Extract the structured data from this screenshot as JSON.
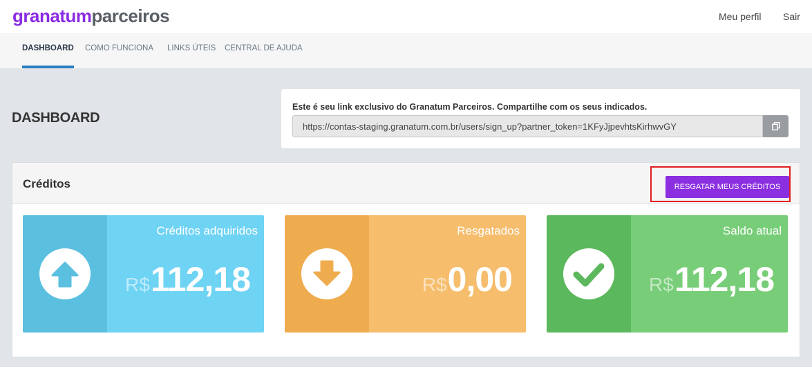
{
  "brand": {
    "part1": "granatum",
    "part2": "parceiros"
  },
  "topnav": {
    "profile": "Meu perfil",
    "logout": "Sair"
  },
  "nav": {
    "items": [
      {
        "label": "DASHBOARD",
        "active": true
      },
      {
        "label": "COMO FUNCIONA",
        "active": false
      },
      {
        "label": "LINKS ÚTEIS",
        "active": false
      },
      {
        "label": "CENTRAL DE AJUDA",
        "active": false
      }
    ]
  },
  "page": {
    "title": "DASHBOARD"
  },
  "referral": {
    "label": "Este é seu link exclusivo do Granatum Parceiros. Compartilhe com os seus indicados.",
    "url": "https://contas-staging.granatum.com.br/users/sign_up?partner_token=1KFyJjpevhtsKirhwvGY",
    "copy_icon": "copy-icon"
  },
  "credits": {
    "title": "Créditos",
    "redeem_button": "RESGATAR MEUS CRÉDITOS",
    "cards": [
      {
        "label": "Créditos adquiridos",
        "currency": "R$",
        "amount": "112,18",
        "icon": "arrow-up-icon",
        "color": "#6fd3f4"
      },
      {
        "label": "Resgatados",
        "currency": "R$",
        "amount": "0,00",
        "icon": "arrow-down-icon",
        "color": "#f5bd6c"
      },
      {
        "label": "Saldo atual",
        "currency": "R$",
        "amount": "112,18",
        "icon": "check-icon",
        "color": "#78cd78"
      }
    ]
  },
  "colors": {
    "brand_purple": "#8a2be2",
    "active_tab": "#2a7fc1",
    "highlight_border": "#e21d1d"
  }
}
